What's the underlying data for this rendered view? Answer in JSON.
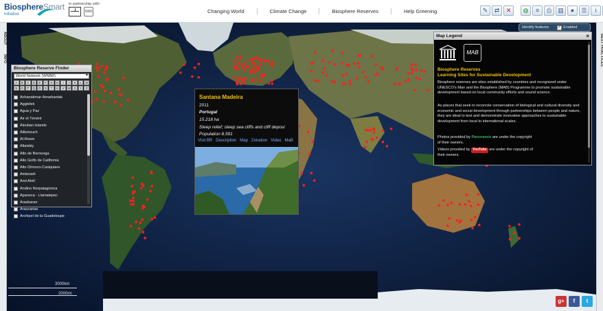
{
  "header": {
    "logo_main": "Biosphere",
    "logo_accent": "Smart",
    "logo_sub": "initiative",
    "partner_text": "in partnership with",
    "mab_mini": "MAB",
    "nav": [
      "Changing World",
      "Climate Change",
      "Biosphere Reserves",
      "Help Greening"
    ]
  },
  "toolbar": {
    "icons": [
      "edit-icon",
      "share-icon",
      "close-icon",
      "globe-icon",
      "layers-icon",
      "print-icon",
      "chart-icon",
      "world-icon",
      "list-icon",
      "info-icon",
      "settings-icon"
    ]
  },
  "side_tabs": {
    "left": [
      "ABOUT",
      "INFO"
    ],
    "right": [
      "BEST PRACTICES"
    ]
  },
  "identify": {
    "label": "Identify features",
    "checkbox_label": "Enabled",
    "checked": true
  },
  "finder": {
    "title": "Biosphere Reserve Finder",
    "selected_network": "World Network (WNBR)",
    "letters": [
      "A",
      "B",
      "C",
      "D",
      "E",
      "F",
      "G",
      "H",
      "I",
      "J",
      "K",
      "L",
      "M",
      "N",
      "O",
      "P",
      "Q",
      "R",
      "S",
      "T",
      "U",
      "V",
      "W",
      "X",
      "Y",
      "Z"
    ],
    "reserves": [
      "Achanakmar-Amarkantak",
      "Aggtelek",
      "Agua y Paz",
      "Air et Ténéré",
      "Aleutian Islands",
      "Alibotouch",
      "Al-Reem",
      "Altaiskiy",
      "Alto de Berneoga",
      "Alto Golfo de California",
      "Alto Orinoco-Casiquiare",
      "Amboseli",
      "And Atoll",
      "Andino Norpatagónica",
      "Apaneca - Llamatepec",
      "Arasbaran",
      "Araucarias",
      "Archipel de la Guadeloupe"
    ]
  },
  "popup": {
    "name": "Santana Madeira",
    "year": "2011",
    "country": "Portugal",
    "area": "15.218 ha",
    "description": "Steep relief; steep sea cliffs and cliff deposi",
    "population": "Population 8.591",
    "links": [
      "Visit BR",
      "Description",
      "Map",
      "Zonation",
      "Video",
      "MaB"
    ]
  },
  "legend": {
    "title": "Map Legend",
    "mab_logo": "MAB",
    "heading1": "Biosphere Reserves",
    "heading2": "Learning Sites for Sustainable Development",
    "para1": "Biosphere reserves are sites established by countries and recognized under UNESCO's Man and the Biosphere (MAB) Programme to promote sustainable development based on local community efforts and sound science.",
    "para2": "As places that seek to reconcile conservation of biological and cultural diversity and economic and social development through partnerships between people and nature, they are ideal to test and demonstrate innovative approaches to sustainable development from local to international scales.",
    "photos_prefix": "Photos provided by",
    "photos_brand": "Panoramio",
    "photos_suffix": "are under the copyright",
    "photos_suffix2": "of their owners.",
    "videos_prefix": "Videos provided by",
    "videos_brand": "YouTube",
    "videos_suffix": "are under the copyright of",
    "videos_suffix2": "their owners."
  },
  "map": {
    "scale_km": "3000km",
    "scale_mi": "2000mi"
  },
  "social": {
    "icons": [
      "google-plus-icon",
      "facebook-icon",
      "twitter-icon"
    ]
  },
  "colors": {
    "marker": "#ff2020",
    "popup_title": "#f2c400",
    "ocean": "#0d1f3c"
  }
}
